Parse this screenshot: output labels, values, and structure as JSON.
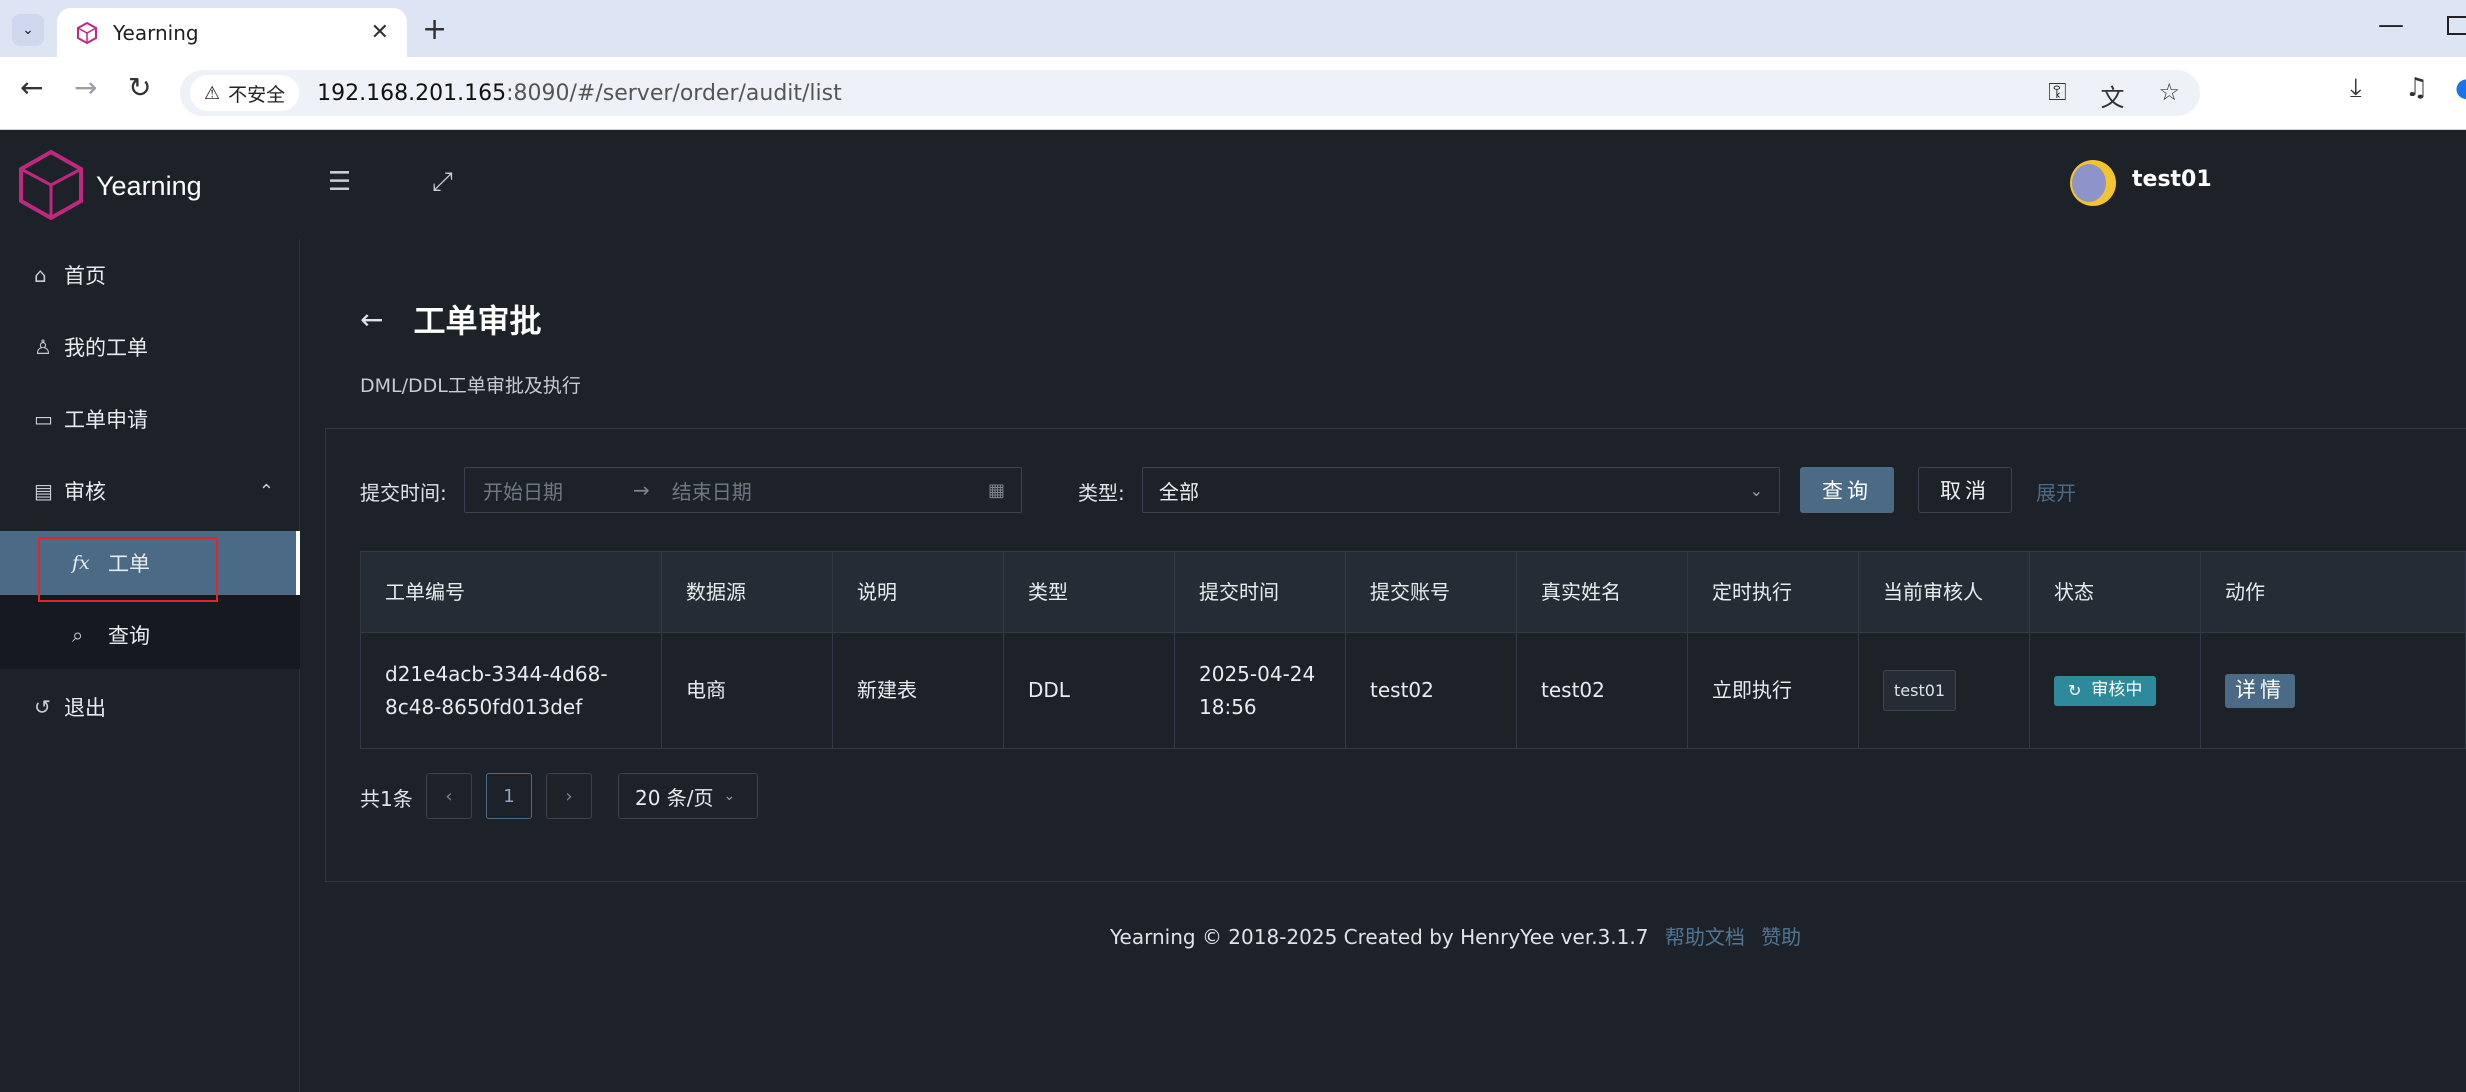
{
  "browser": {
    "tab_title": "Yearning",
    "security_label": "不安全",
    "url_host": "192.168.201.165",
    "url_rest": ":8090/#/server/order/audit/list"
  },
  "app": {
    "name": "Yearning",
    "username": "test01"
  },
  "sidebar": {
    "items": [
      {
        "label": "首页",
        "icon": "home-icon"
      },
      {
        "label": "我的工单",
        "icon": "user-icon"
      },
      {
        "label": "工单申请",
        "icon": "monitor-icon"
      },
      {
        "label": "审核",
        "icon": "audit-icon"
      },
      {
        "label": "工单",
        "icon": "fx-icon"
      },
      {
        "label": "查询",
        "icon": "search-icon"
      },
      {
        "label": "退出",
        "icon": "logout-icon"
      }
    ],
    "fx_glyph": "fx"
  },
  "page": {
    "title": "工单审批",
    "subtitle": "DML/DDL工单审批及执行"
  },
  "filters": {
    "date_label": "提交时间:",
    "start_placeholder": "开始日期",
    "end_placeholder": "结束日期",
    "type_label": "类型:",
    "type_value": "全部",
    "search_button": "查询",
    "cancel_button": "取消",
    "expand_link": "展开"
  },
  "table": {
    "headers": [
      "工单编号",
      "数据源",
      "说明",
      "类型",
      "提交时间",
      "提交账号",
      "真实姓名",
      "定时执行",
      "当前审核人",
      "状态",
      "动作"
    ],
    "rows": [
      {
        "id_line1": "d21e4acb-3344-4d68-",
        "id_line2": "8c48-8650fd013def",
        "source": "电商",
        "desc": "新建表",
        "type": "DDL",
        "time_line1": "2025-04-24",
        "time_line2": "18:56",
        "account": "test02",
        "realname": "test02",
        "schedule": "立即执行",
        "auditor": "test01",
        "status": "审核中",
        "action": "详情"
      }
    ]
  },
  "pagination": {
    "total": "共1条",
    "current_page": "1",
    "page_size": "20 条/页"
  },
  "footer": {
    "text": "Yearning © 2018-2025 Created by HenryYee ver.3.1.7",
    "link_docs": "帮助文档",
    "link_sponsor": "赞助"
  },
  "colors": {
    "background": "#1d2229",
    "accent": "#4a6a86",
    "status_teal": "#2e8a9a",
    "highlight": "#e0262b"
  }
}
